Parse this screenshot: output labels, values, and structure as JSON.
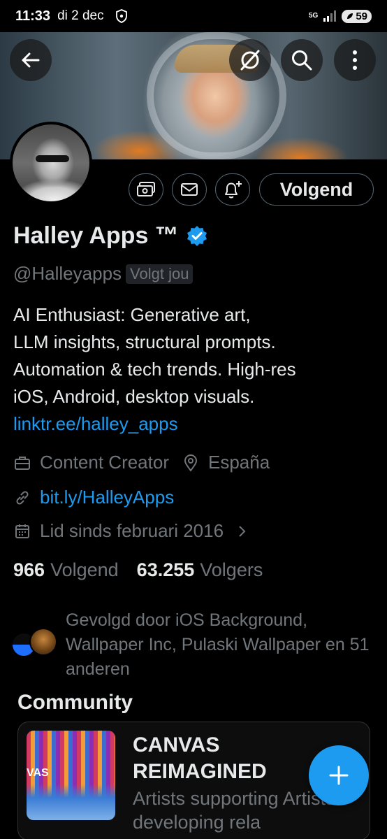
{
  "status_bar": {
    "time": "11:33",
    "date": "di 2 dec",
    "network": "5G",
    "battery": "59"
  },
  "banner": {
    "back_icon": "arrow-left-icon",
    "grok_icon": "slash-circle-icon",
    "search_icon": "search-icon",
    "more_icon": "more-vertical-icon"
  },
  "actions": {
    "subscribe_icon": "money-icon",
    "message_icon": "mail-icon",
    "notify_icon": "bell-plus-icon",
    "follow_label": "Volgend"
  },
  "profile": {
    "name": "Halley Apps ™",
    "verified": true,
    "handle": "@Halleyapps",
    "follows_you": "Volgt jou",
    "bio_lines": [
      "AI Enthusiast: Generative art,",
      "LLM insights, structural prompts.",
      "Automation & tech trends. High-res",
      "iOS, Android, desktop visuals."
    ],
    "bio_link": "linktr.ee/halley_apps",
    "category": "Content Creator",
    "location": "España",
    "website": "bit.ly/HalleyApps",
    "joined": "Lid sinds februari 2016"
  },
  "stats": {
    "following_count": "966",
    "following_label": "Volgend",
    "followers_count": "63.255",
    "followers_label": "Volgers"
  },
  "followed_by": {
    "text": "Gevolgd door iOS Background, Wallpaper Inc, Pulaski Wallpaper en 51 anderen"
  },
  "community": {
    "section_title": "Community",
    "thumb_text": "VAS",
    "name": "CANVAS REIMAGINED",
    "description": "Artists supporting Artists: developing rela"
  },
  "colors": {
    "accent": "#1d9bf0",
    "muted_text": "#71767b",
    "primary_text": "#e7e9ea",
    "background": "#000000"
  }
}
